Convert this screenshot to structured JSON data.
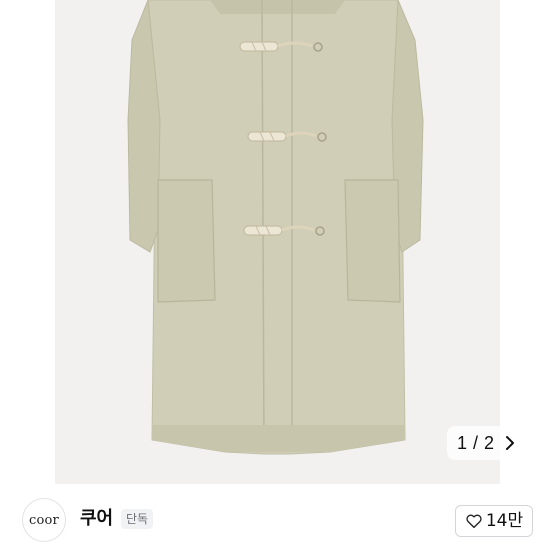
{
  "gallery": {
    "current": "1",
    "separator": "/",
    "total": "2",
    "coat_color": "#cfcdb5",
    "background_color": "#f2f1ef"
  },
  "seller": {
    "logo_text": "coor",
    "name": "쿠어",
    "badge": "단독"
  },
  "like": {
    "count": "14만",
    "icon": "heart-outline-icon"
  }
}
